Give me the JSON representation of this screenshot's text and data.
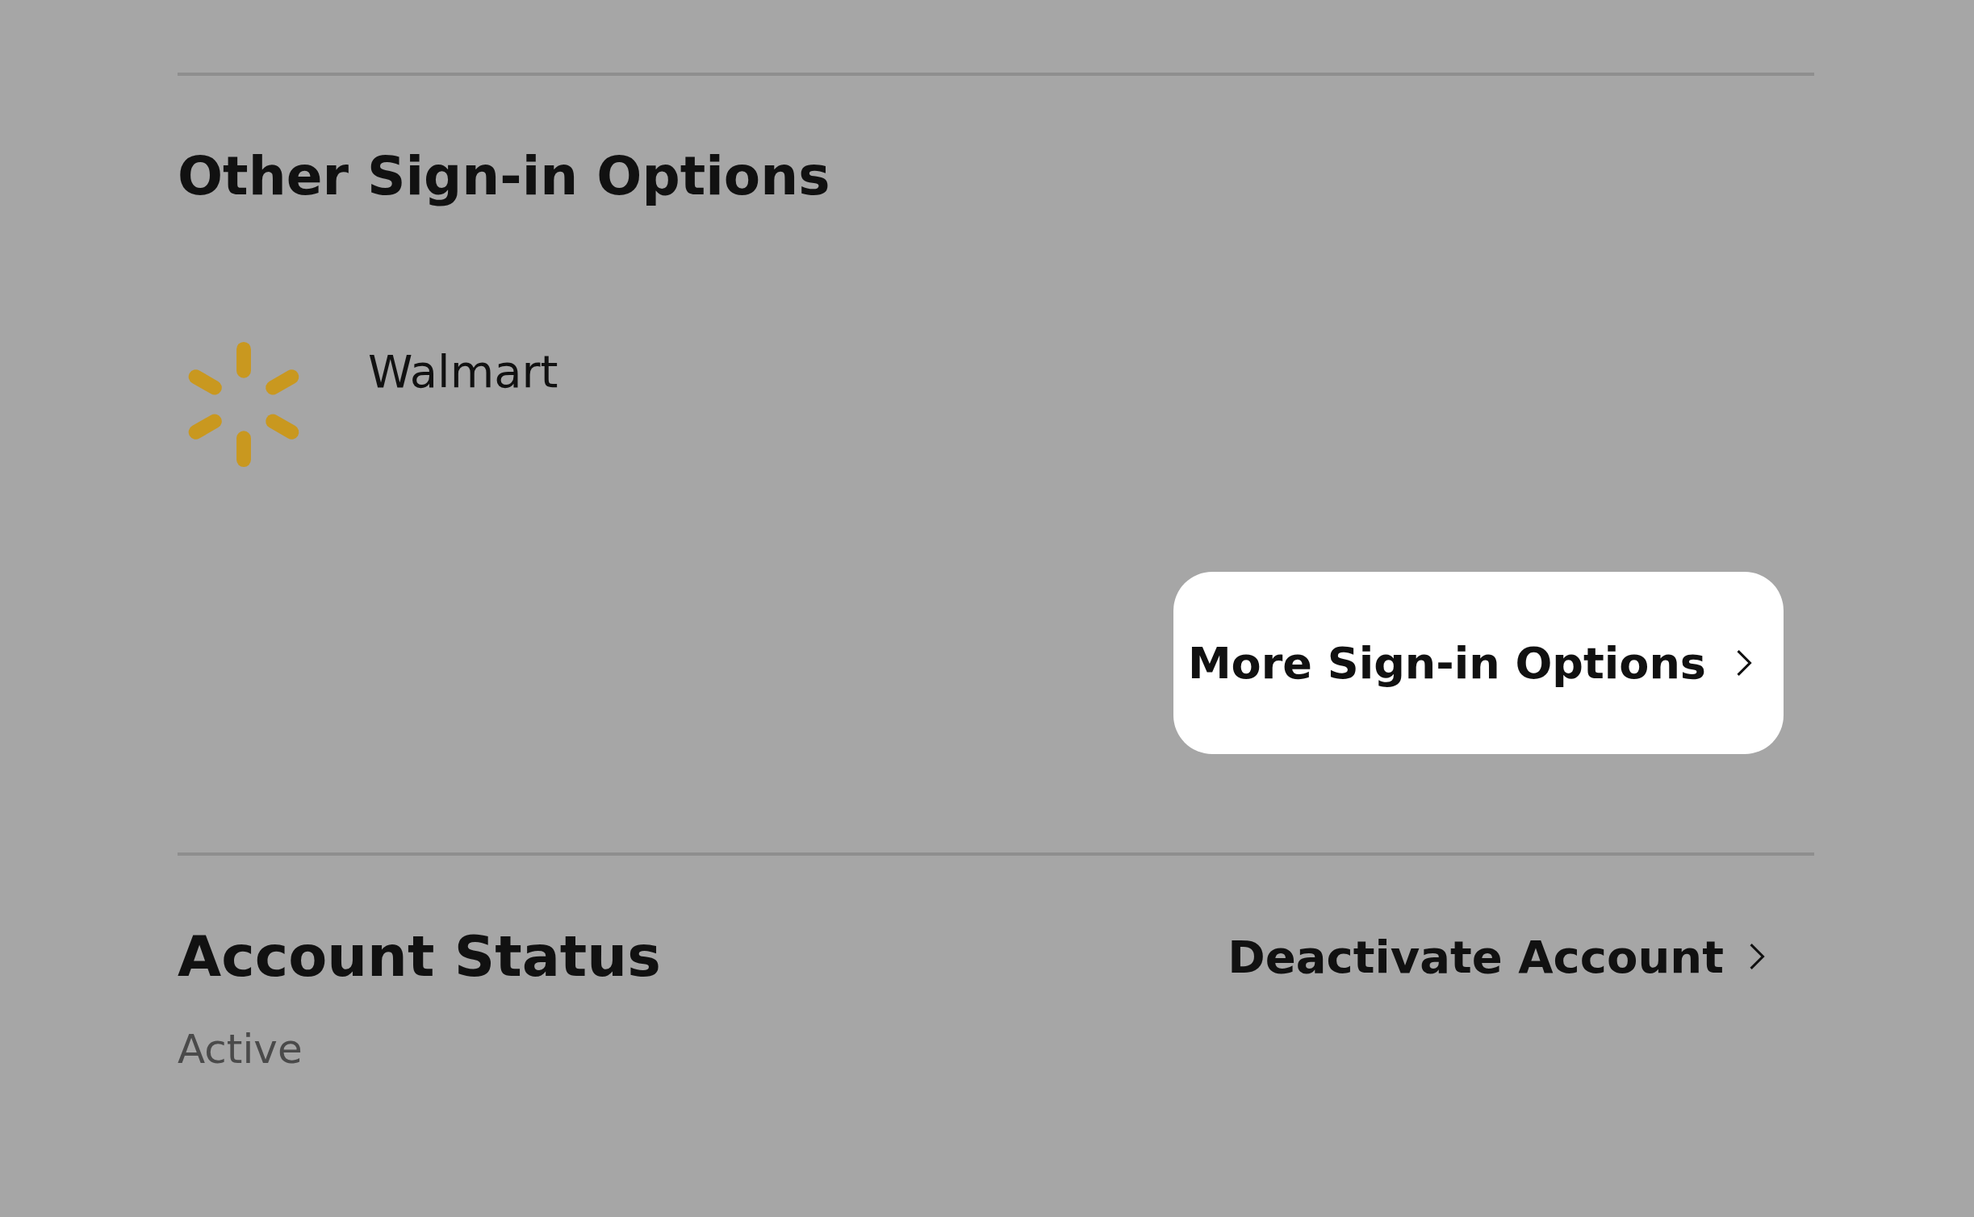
{
  "sign_in_section": {
    "title": "Other Sign-in Options",
    "providers": [
      {
        "name": "Walmart"
      }
    ],
    "more_button": {
      "label": "More Sign-in Options"
    }
  },
  "account_section": {
    "title": "Account Status",
    "action": {
      "label": "Deactivate Account"
    },
    "status": "Active"
  }
}
